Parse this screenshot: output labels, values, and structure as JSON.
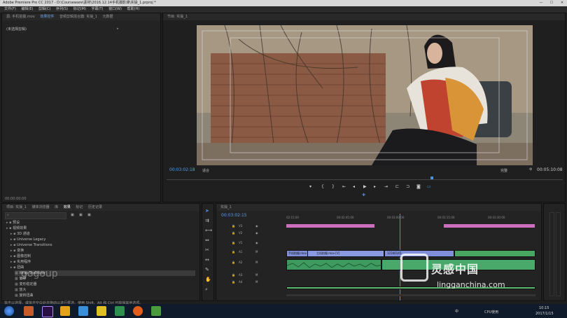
{
  "window": {
    "title": "Adobe Premiere Pro CC 2017 - D:\\Courseware\\素材\\2016.12.14手机摄影课\\实操_1.prproj *"
  },
  "menu": [
    "文件(F)",
    "编辑(E)",
    "剪辑(C)",
    "序列(S)",
    "标记(M)",
    "字幕(T)",
    "窗口(W)",
    "帮助(H)"
  ],
  "source_panel": {
    "tabs": [
      "源: 手机拍摄.mov",
      "效果控件",
      "音频剪辑混合器: 实操_1",
      "元数据"
    ],
    "empty_label": "(未选择剪辑)",
    "timecode": "00:00:00:00"
  },
  "program_panel": {
    "tab": "节目: 实操_1",
    "timecode_current": "00:03:02:18",
    "fit_label": "适合",
    "quality_label": "完整",
    "timecode_duration": "00:05:10:08"
  },
  "effects_panel": {
    "tabs": [
      "项目: 实操_1",
      "媒体浏览器",
      "库",
      "效果",
      "标记",
      "历史记录"
    ],
    "search_placeholder": "",
    "items": [
      {
        "label": "预设",
        "depth": 0
      },
      {
        "label": "视频效果",
        "depth": 0
      },
      {
        "label": "3D 通道",
        "depth": 1
      },
      {
        "label": "Universe Legacy",
        "depth": 1
      },
      {
        "label": "Universe Transitions",
        "depth": 1
      },
      {
        "label": "变换",
        "depth": 1
      },
      {
        "label": "图像控制",
        "depth": 1
      },
      {
        "label": "实用程序",
        "depth": 1
      },
      {
        "label": "扭曲",
        "depth": 1
      },
      {
        "label": "Wrap Stabilizer",
        "depth": 2
      },
      {
        "label": "偏移",
        "depth": 2
      },
      {
        "label": "变形稳定器",
        "depth": 2
      },
      {
        "label": "放大",
        "depth": 2
      },
      {
        "label": "旋转扭曲",
        "depth": 2
      }
    ]
  },
  "timeline": {
    "tab": "实操_1",
    "timecode": "00:03:02:15",
    "ruler": [
      "02:15:00",
      "00:02:45:00",
      "00:03:00:00",
      "00:03:15:00",
      "00:03:30:00"
    ],
    "video_tracks": [
      "V3",
      "V2",
      "V1"
    ],
    "audio_tracks": [
      "A1",
      "A2",
      "A3",
      "A4"
    ],
    "clips": [
      "手机拍摄.mov [V]",
      "主机拍摄.mov [V]",
      "12340145"
    ]
  },
  "status_bar": {
    "text": "单击以选择，或单击空白处并拖动以进行框选。使用 Shift、Alt 和 Ctrl 可获得其他选项。"
  },
  "taskbar": {
    "time": "10:15",
    "date": "2017/1/15",
    "input_method": "中",
    "cpu": "CPU使用"
  },
  "watermark": {
    "site": "lingganchina.com",
    "left_mark": "gogoup"
  }
}
